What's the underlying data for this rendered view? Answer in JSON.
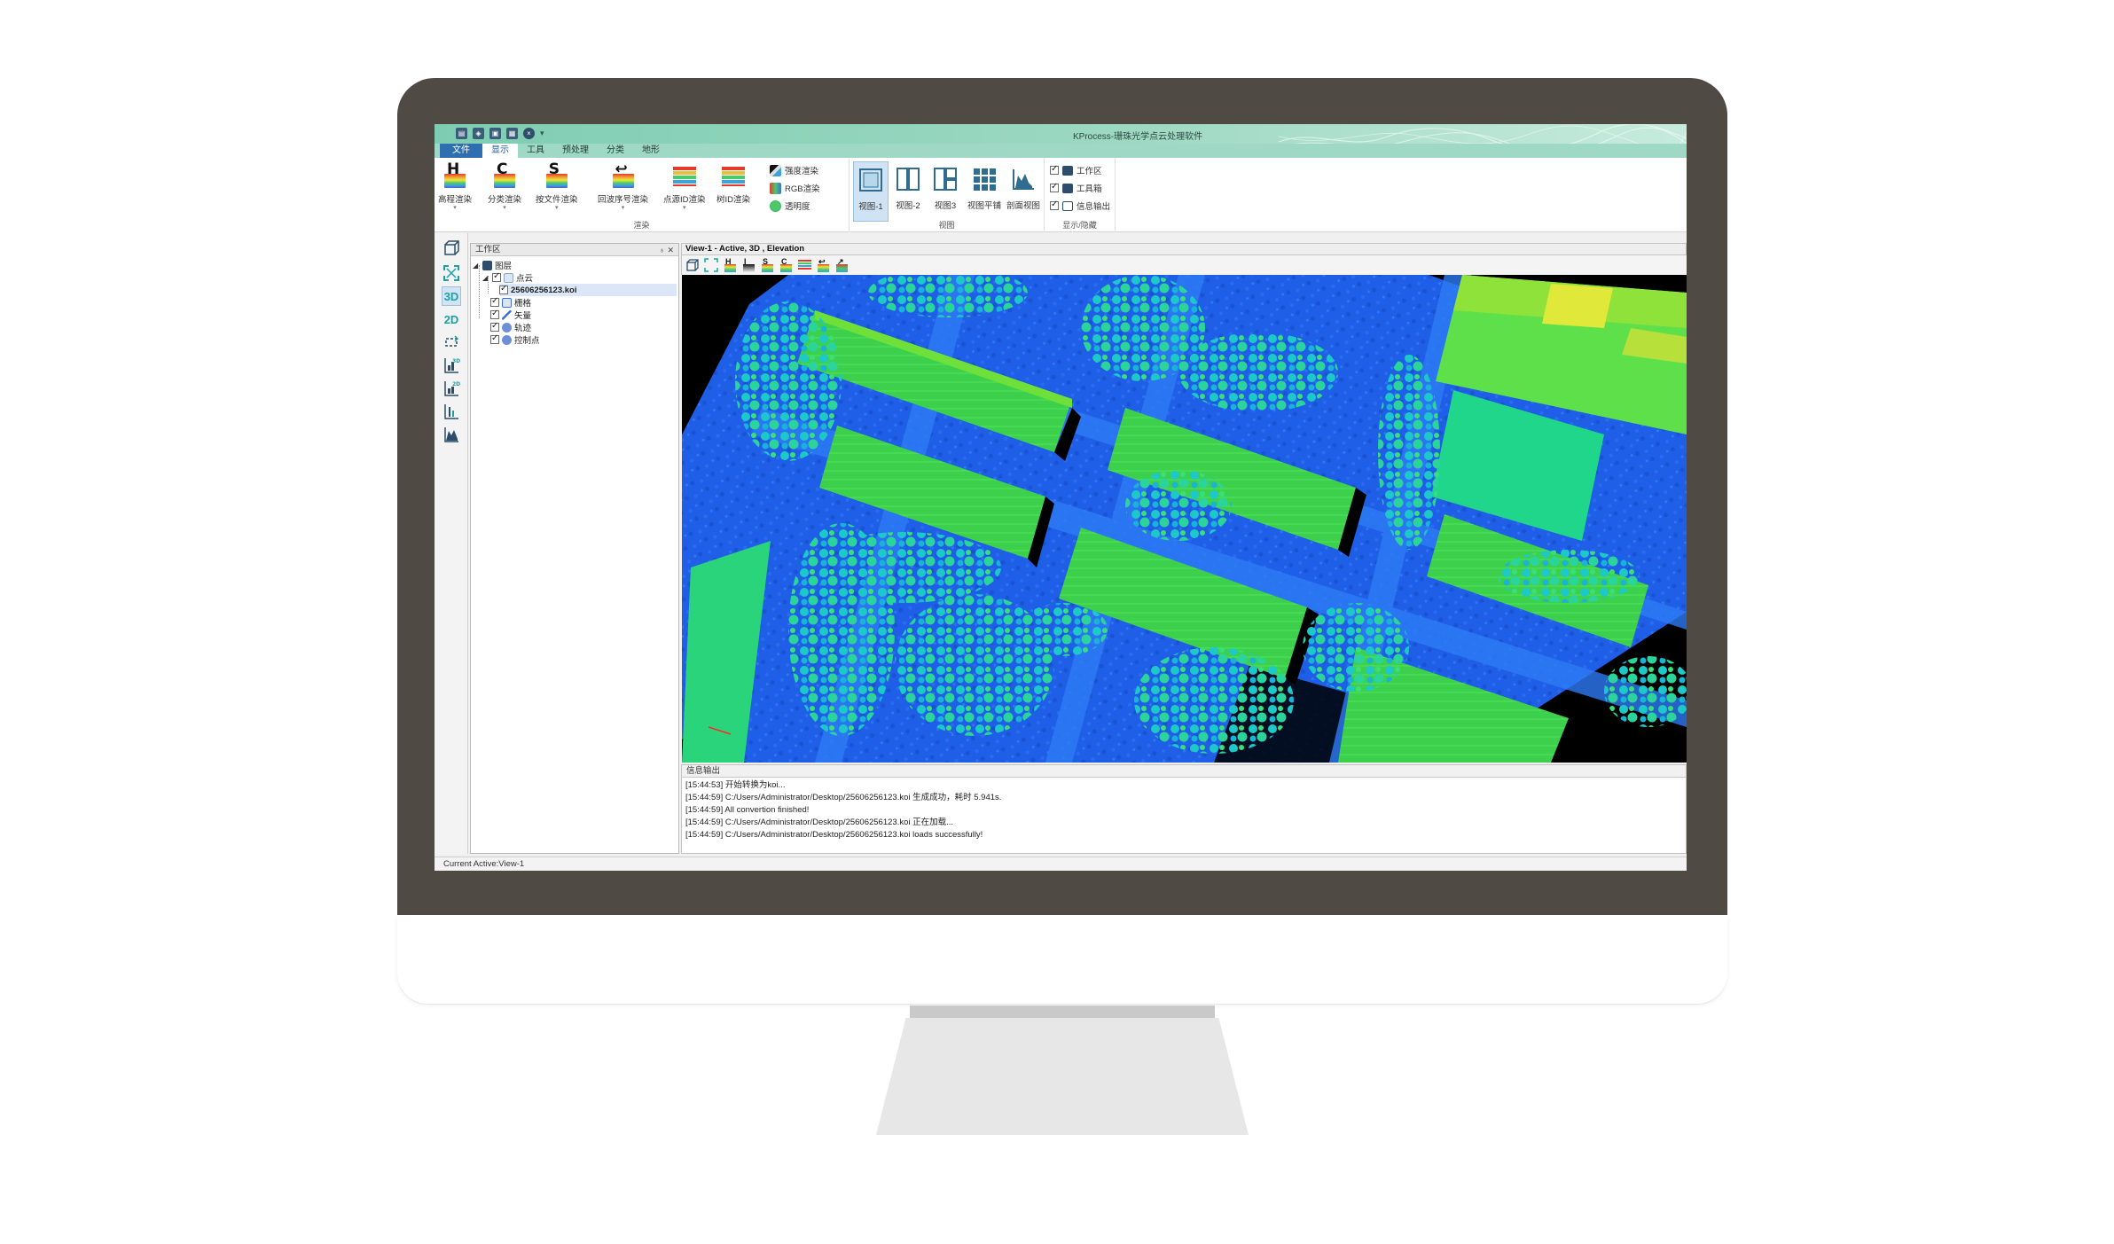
{
  "app": {
    "title": "KProcess-珊珠光学点云处理软件"
  },
  "tabs": [
    {
      "label": "文件"
    },
    {
      "label": "显示"
    },
    {
      "label": "工具"
    },
    {
      "label": "预处理"
    },
    {
      "label": "分类"
    },
    {
      "label": "地形"
    }
  ],
  "ribbon": {
    "render_group": {
      "label": "渲染",
      "buttons": [
        {
          "label": "高程渲染",
          "letter": "H"
        },
        {
          "label": "分类渲染",
          "letter": "C"
        },
        {
          "label": "按文件渲染",
          "letter": "S"
        },
        {
          "label": "回波序号渲染",
          "letter": "↩"
        },
        {
          "label": "点源ID渲染",
          "letter": ""
        },
        {
          "label": "树ID渲染",
          "letter": ""
        }
      ],
      "small": [
        {
          "label": "强度渲染"
        },
        {
          "label": "RGB渲染"
        },
        {
          "label": "透明度"
        }
      ]
    },
    "view_group": {
      "label": "视图",
      "buttons": [
        {
          "label": "视图-1"
        },
        {
          "label": "视图-2"
        },
        {
          "label": "视图3"
        },
        {
          "label": "视图平铺"
        },
        {
          "label": "剖面视图"
        }
      ]
    },
    "show_group": {
      "label": "显示/隐藏",
      "items": [
        {
          "label": "工作区",
          "checked": true
        },
        {
          "label": "工具箱",
          "checked": true
        },
        {
          "label": "信息输出",
          "checked": true
        }
      ]
    }
  },
  "toolbar_left": {
    "label_3d": "3D",
    "label_2d": "2D"
  },
  "workspace": {
    "title": "工作区",
    "pin": "♁ ✕",
    "tree": {
      "root": "图层",
      "cloud": "点云",
      "file": "25606256123.koi",
      "raster": "栅格",
      "vector": "矢量",
      "track": "轨迹",
      "control": "控制点"
    }
  },
  "view": {
    "header": "View-1 - Active, 3D , Elevation"
  },
  "info": {
    "title": "信息输出",
    "lines": [
      "[15:44:53]  开始转换为koi...",
      "[15:44:59] C:/Users/Administrator/Desktop/25606256123.koi 生成成功，耗时 5.941s.",
      "[15:44:59] All convertion finished!",
      "[15:44:59] C:/Users/Administrator/Desktop/25606256123.koi 正在加载...",
      "[15:44:59] C:/Users/Administrator/Desktop/25606256123.koi loads successfully!"
    ]
  },
  "status": {
    "text": "Current Active:View-1"
  },
  "colors": {
    "titlebar": "#8fd4bd",
    "file_tab": "#2f6fb0",
    "bezel": "#4f4b44",
    "ground_blue": "#1f5ee6",
    "roof_green": "#35d35a",
    "tree_cyan": "#1fc8c8"
  }
}
